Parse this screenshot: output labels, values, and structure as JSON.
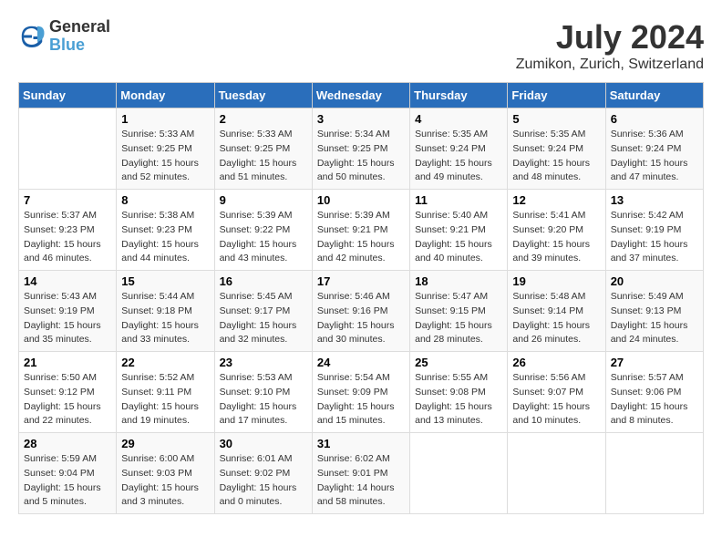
{
  "header": {
    "logo_line1": "General",
    "logo_line2": "Blue",
    "month_year": "July 2024",
    "location": "Zumikon, Zurich, Switzerland"
  },
  "weekdays": [
    "Sunday",
    "Monday",
    "Tuesday",
    "Wednesday",
    "Thursday",
    "Friday",
    "Saturday"
  ],
  "weeks": [
    [
      {
        "day": null
      },
      {
        "day": "1",
        "sunrise": "5:33 AM",
        "sunset": "9:25 PM",
        "daylight": "15 hours and 52 minutes."
      },
      {
        "day": "2",
        "sunrise": "5:33 AM",
        "sunset": "9:25 PM",
        "daylight": "15 hours and 51 minutes."
      },
      {
        "day": "3",
        "sunrise": "5:34 AM",
        "sunset": "9:25 PM",
        "daylight": "15 hours and 50 minutes."
      },
      {
        "day": "4",
        "sunrise": "5:35 AM",
        "sunset": "9:24 PM",
        "daylight": "15 hours and 49 minutes."
      },
      {
        "day": "5",
        "sunrise": "5:35 AM",
        "sunset": "9:24 PM",
        "daylight": "15 hours and 48 minutes."
      },
      {
        "day": "6",
        "sunrise": "5:36 AM",
        "sunset": "9:24 PM",
        "daylight": "15 hours and 47 minutes."
      }
    ],
    [
      {
        "day": "7",
        "sunrise": "5:37 AM",
        "sunset": "9:23 PM",
        "daylight": "15 hours and 46 minutes."
      },
      {
        "day": "8",
        "sunrise": "5:38 AM",
        "sunset": "9:23 PM",
        "daylight": "15 hours and 44 minutes."
      },
      {
        "day": "9",
        "sunrise": "5:39 AM",
        "sunset": "9:22 PM",
        "daylight": "15 hours and 43 minutes."
      },
      {
        "day": "10",
        "sunrise": "5:39 AM",
        "sunset": "9:21 PM",
        "daylight": "15 hours and 42 minutes."
      },
      {
        "day": "11",
        "sunrise": "5:40 AM",
        "sunset": "9:21 PM",
        "daylight": "15 hours and 40 minutes."
      },
      {
        "day": "12",
        "sunrise": "5:41 AM",
        "sunset": "9:20 PM",
        "daylight": "15 hours and 39 minutes."
      },
      {
        "day": "13",
        "sunrise": "5:42 AM",
        "sunset": "9:19 PM",
        "daylight": "15 hours and 37 minutes."
      }
    ],
    [
      {
        "day": "14",
        "sunrise": "5:43 AM",
        "sunset": "9:19 PM",
        "daylight": "15 hours and 35 minutes."
      },
      {
        "day": "15",
        "sunrise": "5:44 AM",
        "sunset": "9:18 PM",
        "daylight": "15 hours and 33 minutes."
      },
      {
        "day": "16",
        "sunrise": "5:45 AM",
        "sunset": "9:17 PM",
        "daylight": "15 hours and 32 minutes."
      },
      {
        "day": "17",
        "sunrise": "5:46 AM",
        "sunset": "9:16 PM",
        "daylight": "15 hours and 30 minutes."
      },
      {
        "day": "18",
        "sunrise": "5:47 AM",
        "sunset": "9:15 PM",
        "daylight": "15 hours and 28 minutes."
      },
      {
        "day": "19",
        "sunrise": "5:48 AM",
        "sunset": "9:14 PM",
        "daylight": "15 hours and 26 minutes."
      },
      {
        "day": "20",
        "sunrise": "5:49 AM",
        "sunset": "9:13 PM",
        "daylight": "15 hours and 24 minutes."
      }
    ],
    [
      {
        "day": "21",
        "sunrise": "5:50 AM",
        "sunset": "9:12 PM",
        "daylight": "15 hours and 22 minutes."
      },
      {
        "day": "22",
        "sunrise": "5:52 AM",
        "sunset": "9:11 PM",
        "daylight": "15 hours and 19 minutes."
      },
      {
        "day": "23",
        "sunrise": "5:53 AM",
        "sunset": "9:10 PM",
        "daylight": "15 hours and 17 minutes."
      },
      {
        "day": "24",
        "sunrise": "5:54 AM",
        "sunset": "9:09 PM",
        "daylight": "15 hours and 15 minutes."
      },
      {
        "day": "25",
        "sunrise": "5:55 AM",
        "sunset": "9:08 PM",
        "daylight": "15 hours and 13 minutes."
      },
      {
        "day": "26",
        "sunrise": "5:56 AM",
        "sunset": "9:07 PM",
        "daylight": "15 hours and 10 minutes."
      },
      {
        "day": "27",
        "sunrise": "5:57 AM",
        "sunset": "9:06 PM",
        "daylight": "15 hours and 8 minutes."
      }
    ],
    [
      {
        "day": "28",
        "sunrise": "5:59 AM",
        "sunset": "9:04 PM",
        "daylight": "15 hours and 5 minutes."
      },
      {
        "day": "29",
        "sunrise": "6:00 AM",
        "sunset": "9:03 PM",
        "daylight": "15 hours and 3 minutes."
      },
      {
        "day": "30",
        "sunrise": "6:01 AM",
        "sunset": "9:02 PM",
        "daylight": "15 hours and 0 minutes."
      },
      {
        "day": "31",
        "sunrise": "6:02 AM",
        "sunset": "9:01 PM",
        "daylight": "14 hours and 58 minutes."
      },
      {
        "day": null
      },
      {
        "day": null
      },
      {
        "day": null
      }
    ]
  ]
}
